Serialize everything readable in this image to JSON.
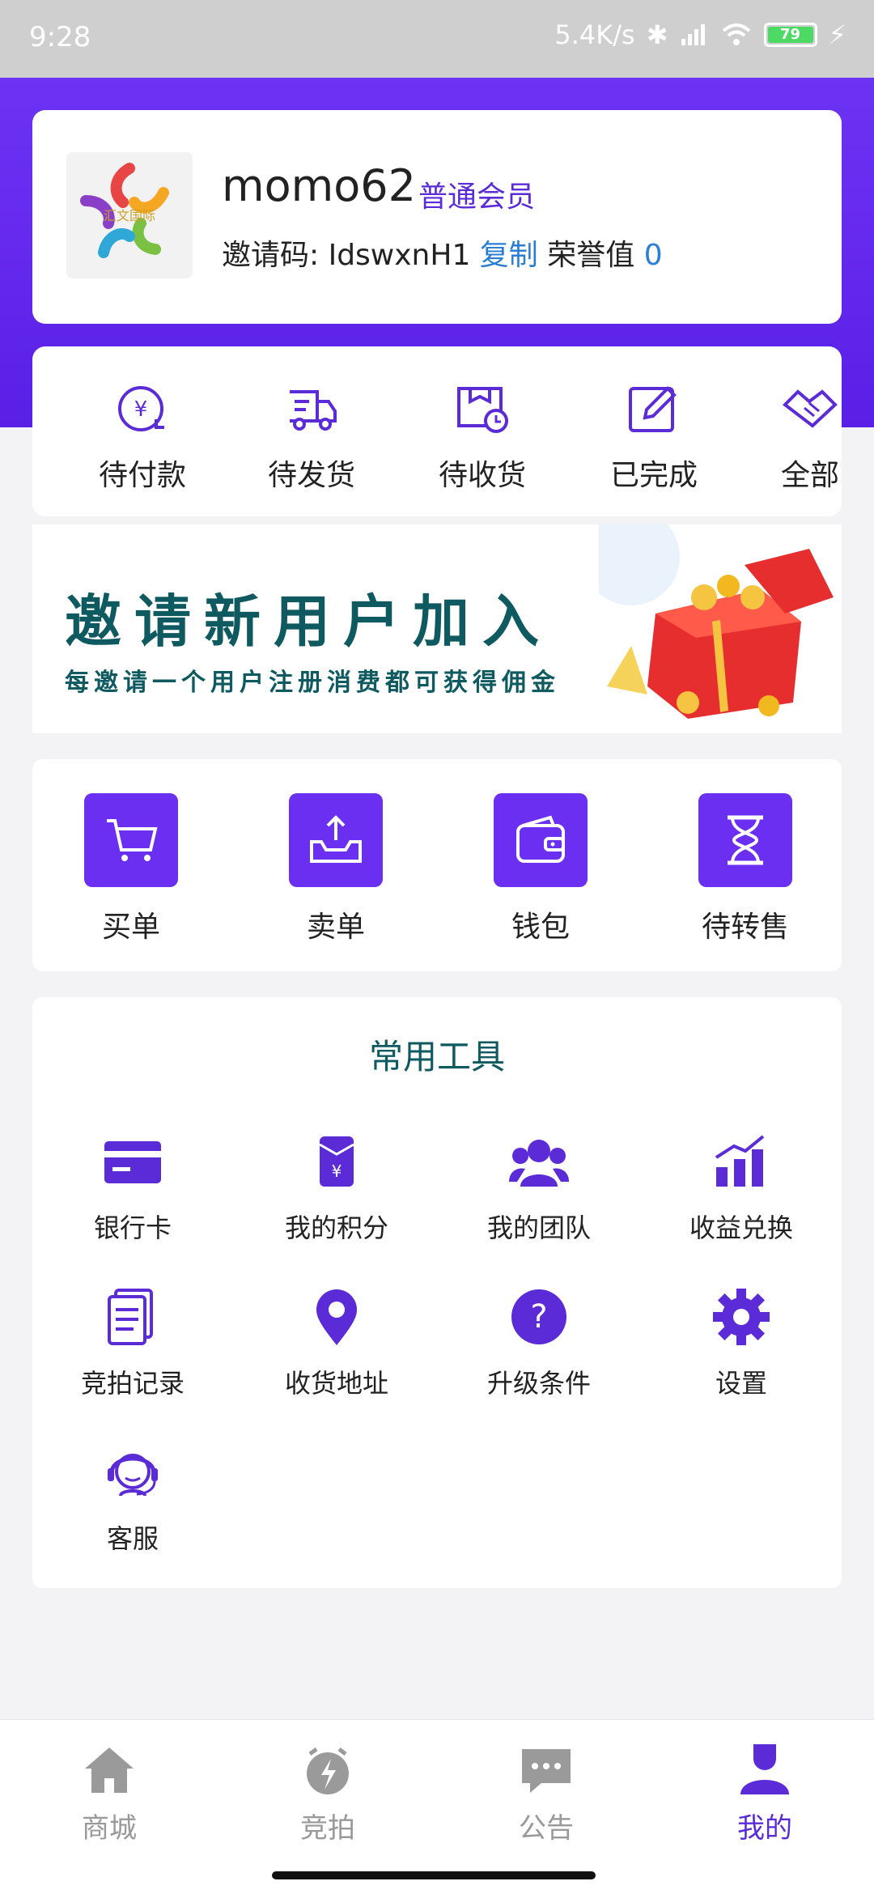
{
  "status_bar": {
    "time": "9:28",
    "net_speed": "5.4K/s",
    "battery": "79"
  },
  "profile": {
    "username": "momo62",
    "level": "普通会员",
    "invite_label": "邀请码: ",
    "invite_code": "IdswxnH1",
    "copy_label": "复制",
    "honor_label": "荣誉值",
    "honor_value": "0",
    "avatar_text": "汇文国际"
  },
  "orders": [
    {
      "label": "待付款",
      "icon": "yen-clock-icon"
    },
    {
      "label": "待发货",
      "icon": "truck-icon"
    },
    {
      "label": "待收货",
      "icon": "receive-clock-icon"
    },
    {
      "label": "已完成",
      "icon": "edit-icon"
    },
    {
      "label": "全部",
      "icon": "handshake-icon"
    }
  ],
  "banner": {
    "title": "邀请新用户加入",
    "subtitle": "每邀请一个用户注册消费都可获得佣金"
  },
  "actions": [
    {
      "label": "买单",
      "icon": "cart-icon"
    },
    {
      "label": "卖单",
      "icon": "upload-tray-icon"
    },
    {
      "label": "钱包",
      "icon": "wallet-icon"
    },
    {
      "label": "待转售",
      "icon": "hourglass-icon"
    }
  ],
  "tools": {
    "title": "常用工具",
    "items": [
      {
        "label": "银行卡",
        "icon": "bank-card-icon"
      },
      {
        "label": "我的积分",
        "icon": "points-icon"
      },
      {
        "label": "我的团队",
        "icon": "team-icon"
      },
      {
        "label": "收益兑换",
        "icon": "chart-icon"
      },
      {
        "label": "竞拍记录",
        "icon": "document-icon"
      },
      {
        "label": "收货地址",
        "icon": "location-icon"
      },
      {
        "label": "升级条件",
        "icon": "question-icon"
      },
      {
        "label": "设置",
        "icon": "gear-icon"
      },
      {
        "label": "客服",
        "icon": "customer-service-icon"
      }
    ]
  },
  "bottom_nav": [
    {
      "label": "商城",
      "icon": "home-icon",
      "active": false
    },
    {
      "label": "竞拍",
      "icon": "auction-icon",
      "active": false
    },
    {
      "label": "公告",
      "icon": "message-icon",
      "active": false
    },
    {
      "label": "我的",
      "icon": "user-icon",
      "active": true
    }
  ],
  "colors": {
    "brand": "#6a2ff0",
    "teal_text": "#0e5a60",
    "link": "#2a7fd4"
  }
}
